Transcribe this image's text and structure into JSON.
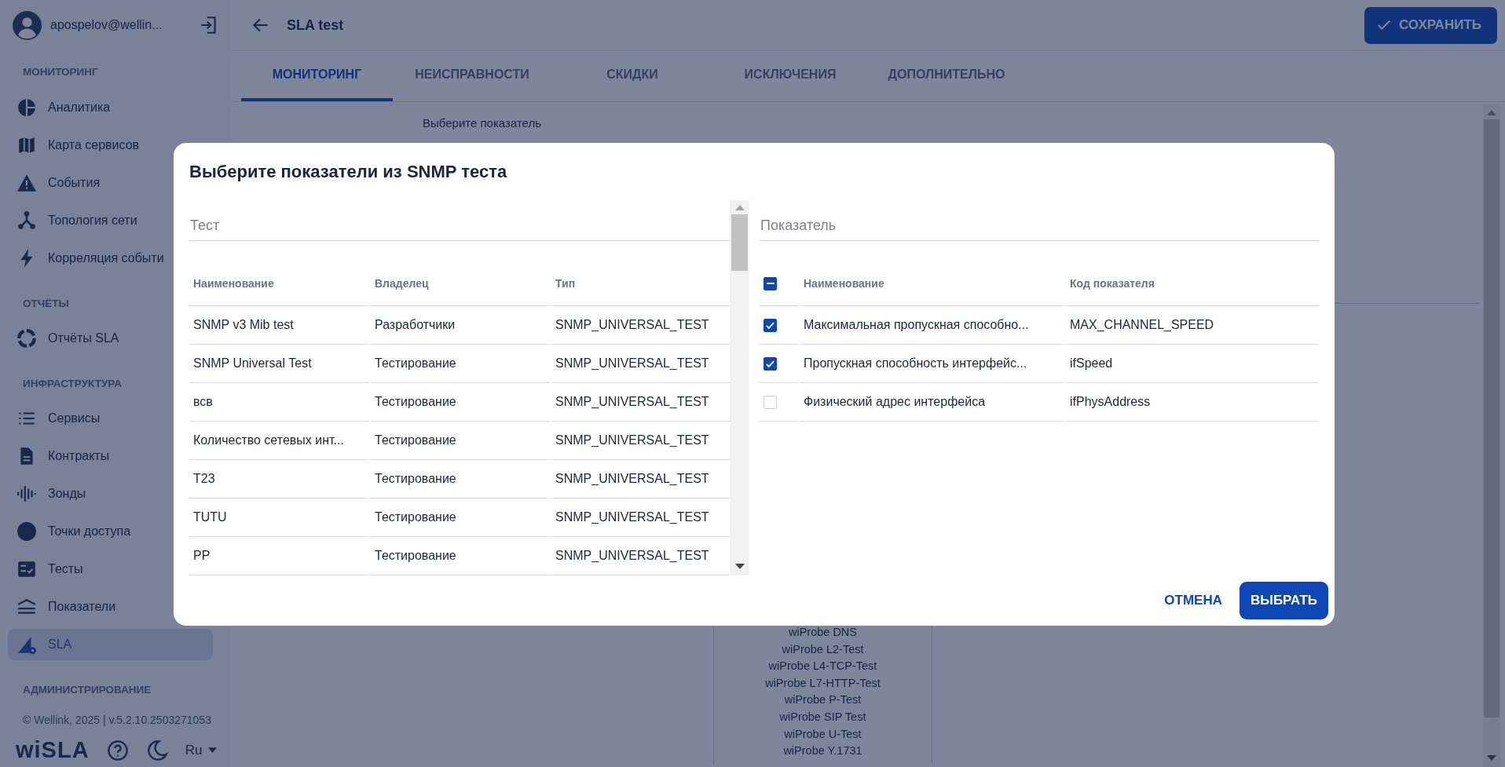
{
  "user": {
    "name": "apospelov@wellin..."
  },
  "sidebar": {
    "sections": [
      {
        "title": "МОНИТОРИНГ",
        "items": [
          {
            "label": "Аналитика",
            "selected": false
          },
          {
            "label": "Карта сервисов",
            "selected": false
          },
          {
            "label": "События",
            "selected": false
          },
          {
            "label": "Топология сети",
            "selected": false
          },
          {
            "label": "Корреляция событи",
            "selected": false
          }
        ]
      },
      {
        "title": "ОТЧЁТЫ",
        "items": [
          {
            "label": "Отчёты SLA",
            "selected": false
          }
        ]
      },
      {
        "title": "ИНФРАСТРУКТУРА",
        "items": [
          {
            "label": "Сервисы",
            "selected": false
          },
          {
            "label": "Контракты",
            "selected": false
          },
          {
            "label": "Зонды",
            "selected": false
          },
          {
            "label": "Точки доступа",
            "selected": false
          },
          {
            "label": "Тесты",
            "selected": false
          },
          {
            "label": "Показатели",
            "selected": false
          },
          {
            "label": "SLA",
            "selected": true
          }
        ]
      },
      {
        "title": "АДМИНИСТРИРОВАНИЕ"
      }
    ],
    "copyright": "© Wellink, 2025 | v.5.2.10.2503271053",
    "logo": "wiSLA",
    "language": "Ru"
  },
  "header": {
    "title": "SLA test",
    "save_button": "СОХРАНИТЬ"
  },
  "tabs": [
    {
      "label": "МОНИТОРИНГ",
      "selected": true
    },
    {
      "label": "НЕИСПРАВНОСТИ",
      "selected": false
    },
    {
      "label": "СКИДКИ",
      "selected": false
    },
    {
      "label": "ИСКЛЮЧЕНИЯ",
      "selected": false
    },
    {
      "label": "ДОПОЛНИТЕЛЬНО",
      "selected": false
    }
  ],
  "content": {
    "label": "Выберите показатель",
    "probe_list": [
      "wiProbe DNS",
      "wiProbe L2-Test",
      "wiProbe L4-TCP-Test",
      "wiProbe L7-HTTP-Test",
      "wiProbe P-Test",
      "wiProbe SIP Test",
      "wiProbe U-Test",
      "wiProbe Y.1731"
    ]
  },
  "dialog": {
    "title": "Выберите показатели из SNMP теста",
    "tests": {
      "field_label": "Тест",
      "columns": [
        "Наименование",
        "Владелец",
        "Тип"
      ],
      "rows": [
        [
          "SNMP v3 Mib test",
          "Разработчики",
          "SNMP_UNIVERSAL_TEST"
        ],
        [
          "SNMP Universal Test",
          "Тестирование",
          "SNMP_UNIVERSAL_TEST"
        ],
        [
          "всв",
          "Тестирование",
          "SNMP_UNIVERSAL_TEST"
        ],
        [
          "Количество сетевых инт...",
          "Тестирование",
          "SNMP_UNIVERSAL_TEST"
        ],
        [
          "T23",
          "Тестирование",
          "SNMP_UNIVERSAL_TEST"
        ],
        [
          "TUTU",
          "Тестирование",
          "SNMP_UNIVERSAL_TEST"
        ],
        [
          "PP",
          "Тестирование",
          "SNMP_UNIVERSAL_TEST"
        ]
      ]
    },
    "metrics": {
      "field_label": "Показатель",
      "select_all": {
        "indeterminate": true
      },
      "columns": [
        "Наименование",
        "Код показателя"
      ],
      "rows": [
        {
          "name": "Максимальная пропускная способно...",
          "code": "MAX_CHANNEL_SPEED",
          "checked": true
        },
        {
          "name": "Пропускная способность интерфейс...",
          "code": "ifSpeed",
          "checked": true
        },
        {
          "name": "Физический адрес интерфейса",
          "code": "ifPhysAddress",
          "checked": false
        }
      ]
    },
    "cancel_button": "ОТМЕНА",
    "select_button": "ВЫБРАТЬ"
  }
}
